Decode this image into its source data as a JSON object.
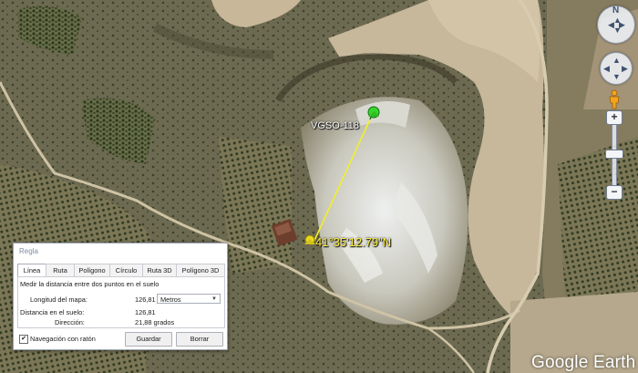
{
  "map": {
    "placemark_label": "VGSO-118",
    "endpoint_label": "41°35'12.79\"N",
    "watermark": "Google Earth"
  },
  "colors": {
    "measure_line": "#f2ef2c",
    "start_pin": "#35d52a",
    "end_pin": "#e8d91e"
  },
  "navigation": {
    "look_north": "N",
    "plus": "+",
    "minus": "−",
    "icons": [
      "look-joystick-icon",
      "move-joystick-icon",
      "street-view-pegman-icon",
      "zoom-in-icon",
      "zoom-slider-icon",
      "zoom-out-icon"
    ]
  },
  "ruler": {
    "title": "Regla",
    "tabs": [
      "Línea",
      "Ruta",
      "Polígono",
      "Círculo",
      "Ruta 3D",
      "Polígono 3D"
    ],
    "active_tab": "Línea",
    "description": "Medir la distancia entre dos puntos en el suelo",
    "map_length_label": "Longitud del mapa:",
    "map_length_value": "126,81",
    "unit": "Metros",
    "ground_length_label": "Distancia en el suelo:",
    "ground_length_value": "126,81",
    "heading_label": "Dirección:",
    "heading_value": "21,88 grados",
    "mouse_nav_checked": true,
    "mouse_nav_label": "Navegación con ratón",
    "save_label": "Guardar",
    "clear_label": "Borrar"
  }
}
